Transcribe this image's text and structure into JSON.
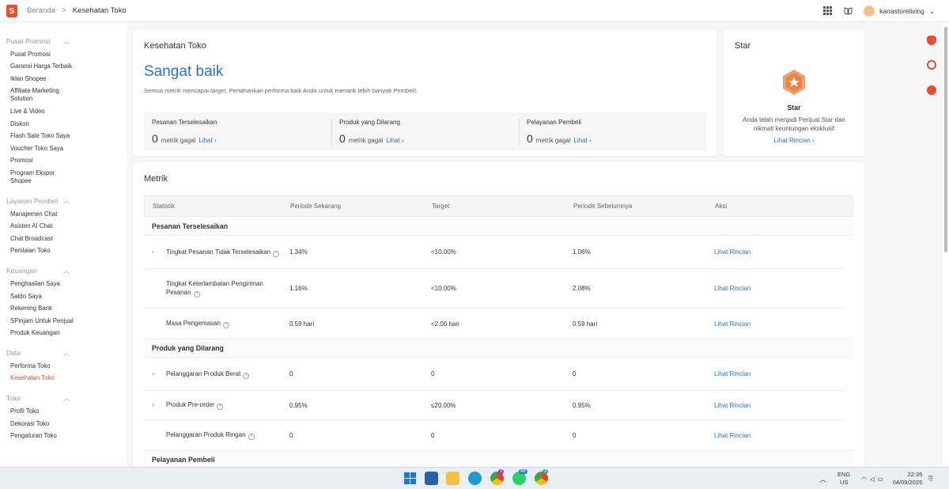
{
  "topbar": {
    "logo_letter": "S",
    "breadcrumb_home": "Beranda",
    "breadcrumb_sep": ">",
    "breadcrumb_current": "Kesehatan Toko",
    "username": "kanastoreliving"
  },
  "sidebar": {
    "sections": [
      {
        "title": "Pusat Promosi",
        "items": [
          "Pusat Promosi",
          "Garansi Harga Terbaik",
          "Iklan Shopee",
          "Affiliate Marketing Solution",
          "Live & Video",
          "Diskon",
          "Flash Sale Toko Saya",
          "Voucher Toko Saya",
          "Promosi",
          "Program Ekspor Shopee"
        ]
      },
      {
        "title": "Layanan Pembeli",
        "items": [
          "Manajemen Chat",
          "Asisten AI Chat",
          "Chat Broadcast",
          "Penilaian Toko"
        ]
      },
      {
        "title": "Keuangan",
        "items": [
          "Penghasilan Saya",
          "Saldo Saya",
          "Rekening Bank",
          "SPinjam Untuk Penjual",
          "Produk Keuangan"
        ]
      },
      {
        "title": "Data",
        "items": [
          "Performa Toko",
          "Kesehatan Toko"
        ]
      },
      {
        "title": "Toko",
        "items": [
          "Profil Toko",
          "Dekorasi Toko",
          "Pengaturan Toko"
        ]
      }
    ],
    "active_item": "Kesehatan Toko"
  },
  "health": {
    "title": "Kesehatan Toko",
    "status": "Sangat baik",
    "note": "Semua metrik mencapai target. Pertahankan performa baik Anda untuk menarik lebih banyak Pembeli!",
    "metrics": [
      {
        "name": "Pesanan Terselesaikan",
        "count": "0",
        "label": "metrik gagal",
        "link": "Lihat"
      },
      {
        "name": "Produk yang Dilarang",
        "count": "0",
        "label": "metrik gagal",
        "link": "Lihat"
      },
      {
        "name": "Pelayanan Pembeli",
        "count": "0",
        "label": "metrik gagal",
        "link": "Lihat"
      }
    ]
  },
  "star": {
    "title": "Star",
    "badge_title": "Star",
    "desc": "Anda telah menjadi Penjual Star dan nikmati keuntungan eksklusif",
    "link": "Lihat Rincian"
  },
  "metrik": {
    "title": "Metrik",
    "headers": [
      "Statistik",
      "Periode Sekarang",
      "Target",
      "Periode Sebelumnya",
      "Aksi"
    ],
    "groups": [
      {
        "name": "Pesanan Terselesaikan",
        "rows": [
          {
            "name": "Tingkat Pesanan Tidak Terselesaikan",
            "current": "1.34%",
            "target": "<10.00%",
            "previous": "1.06%",
            "action": "Lihat Rincian",
            "expandable": true
          },
          {
            "name": "Tingkat Keterlambatan Pengiriman Pesanan",
            "current": "1.16%",
            "target": "<10.00%",
            "previous": "2.08%",
            "action": "Lihat Rincian",
            "expandable": false
          },
          {
            "name": "Masa Pengemasan",
            "current": "0.59 hari",
            "target": "<2.00 hari",
            "previous": "0.59 hari",
            "action": "Lihat Rincian",
            "expandable": false
          }
        ]
      },
      {
        "name": "Produk yang Dilarang",
        "rows": [
          {
            "name": "Pelanggaran Produk Berat",
            "current": "0",
            "target": "0",
            "previous": "0",
            "action": "Lihat Rincian",
            "expandable": true
          },
          {
            "name": "Produk Pre-order",
            "current": "0.95%",
            "target": "≤20.00%",
            "previous": "0.95%",
            "action": "Lihat Rincian",
            "expandable": true
          },
          {
            "name": "Pelanggaran Produk Ringan",
            "current": "0",
            "target": "0",
            "previous": "0",
            "action": "Lihat Rincian",
            "expandable": false
          }
        ]
      },
      {
        "name": "Pelayanan Pembeli",
        "rows": []
      }
    ]
  },
  "taskbar": {
    "lang_top": "ENG",
    "lang_bottom": "US",
    "time": "22:35",
    "date": "04/09/2025",
    "whatsapp_badge": "86",
    "chrome_badge_1": "3",
    "chrome_badge_2": "3"
  },
  "colors": {
    "accent": "#ee4d2d",
    "link": "#2673dd",
    "status": "#2673dd"
  }
}
